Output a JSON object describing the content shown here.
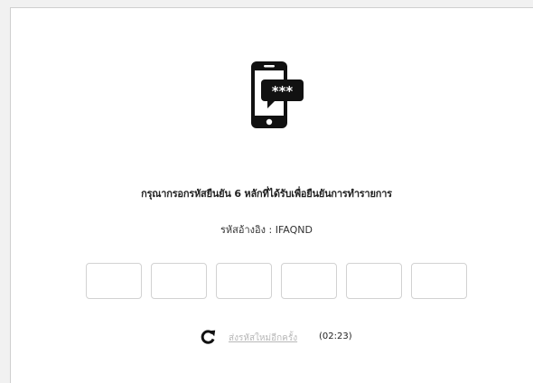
{
  "otp": {
    "title": "กรุณากรอกรหัสยืนยัน 6 หลักที่ได้รับเพื่อยืนยันการทำรายการ",
    "ref_label": "รหัสอ้างอิง : IFAQND",
    "digits": [
      "",
      "",
      "",
      "",
      "",
      ""
    ],
    "resend_label": "ส่งรหัสใหม่อีกครั้ง",
    "timer": "(02:23)",
    "icon": "phone-message-icon",
    "refresh_icon": "refresh-icon"
  },
  "colors": {
    "text": "#222222",
    "link_disabled": "#b8b8b8",
    "box_border": "#d2d2d2"
  }
}
